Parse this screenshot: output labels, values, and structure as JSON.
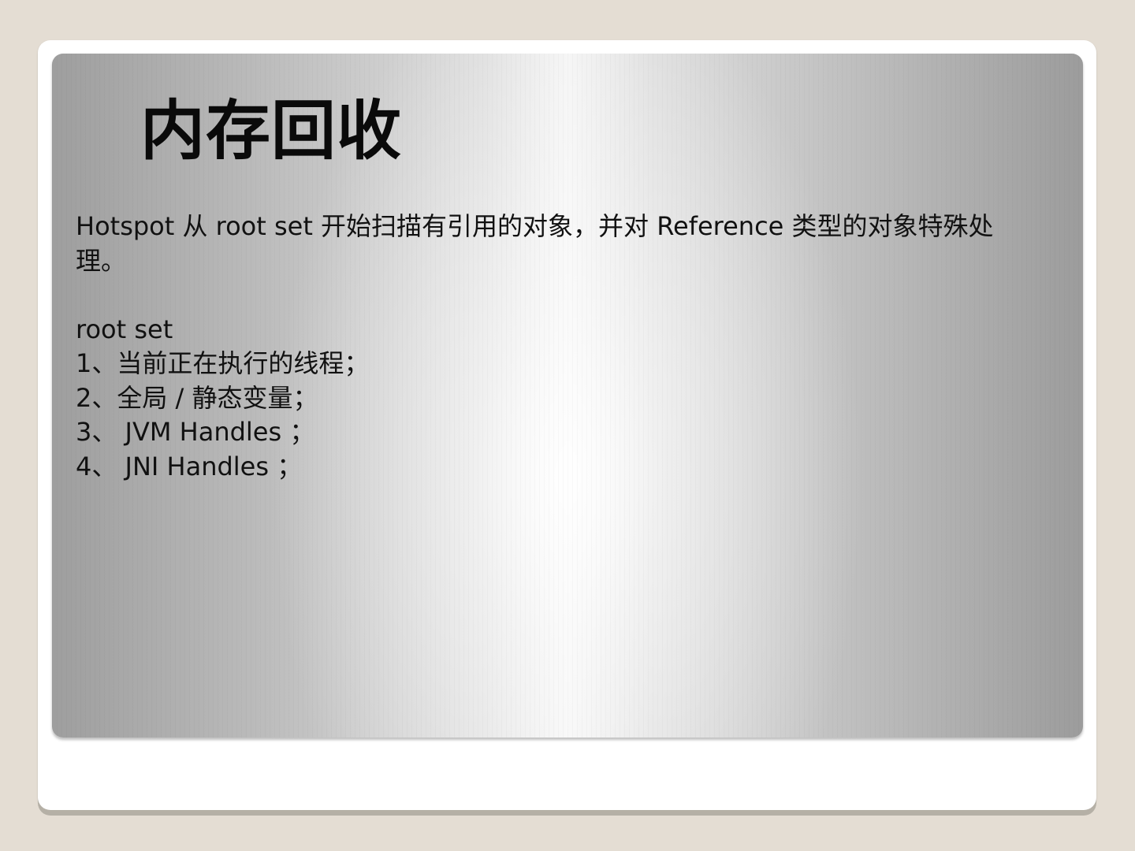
{
  "slide": {
    "title": "内存回收",
    "intro": "Hotspot 从 root set 开始扫描有引用的对象，并对 Reference 类型的对象特殊处理。",
    "list_heading": "root set",
    "items": [
      "1、当前正在执行的线程；",
      "2、全局 / 静态变量；",
      "3、 JVM Handles ；",
      "4、 JNI Handles ；"
    ]
  },
  "colors": {
    "page_background": "#e4ddd3",
    "frame": "#ffffff",
    "panel_edge": "#9e9e9e",
    "panel_center": "#f4f4f4",
    "text": "#111111"
  }
}
